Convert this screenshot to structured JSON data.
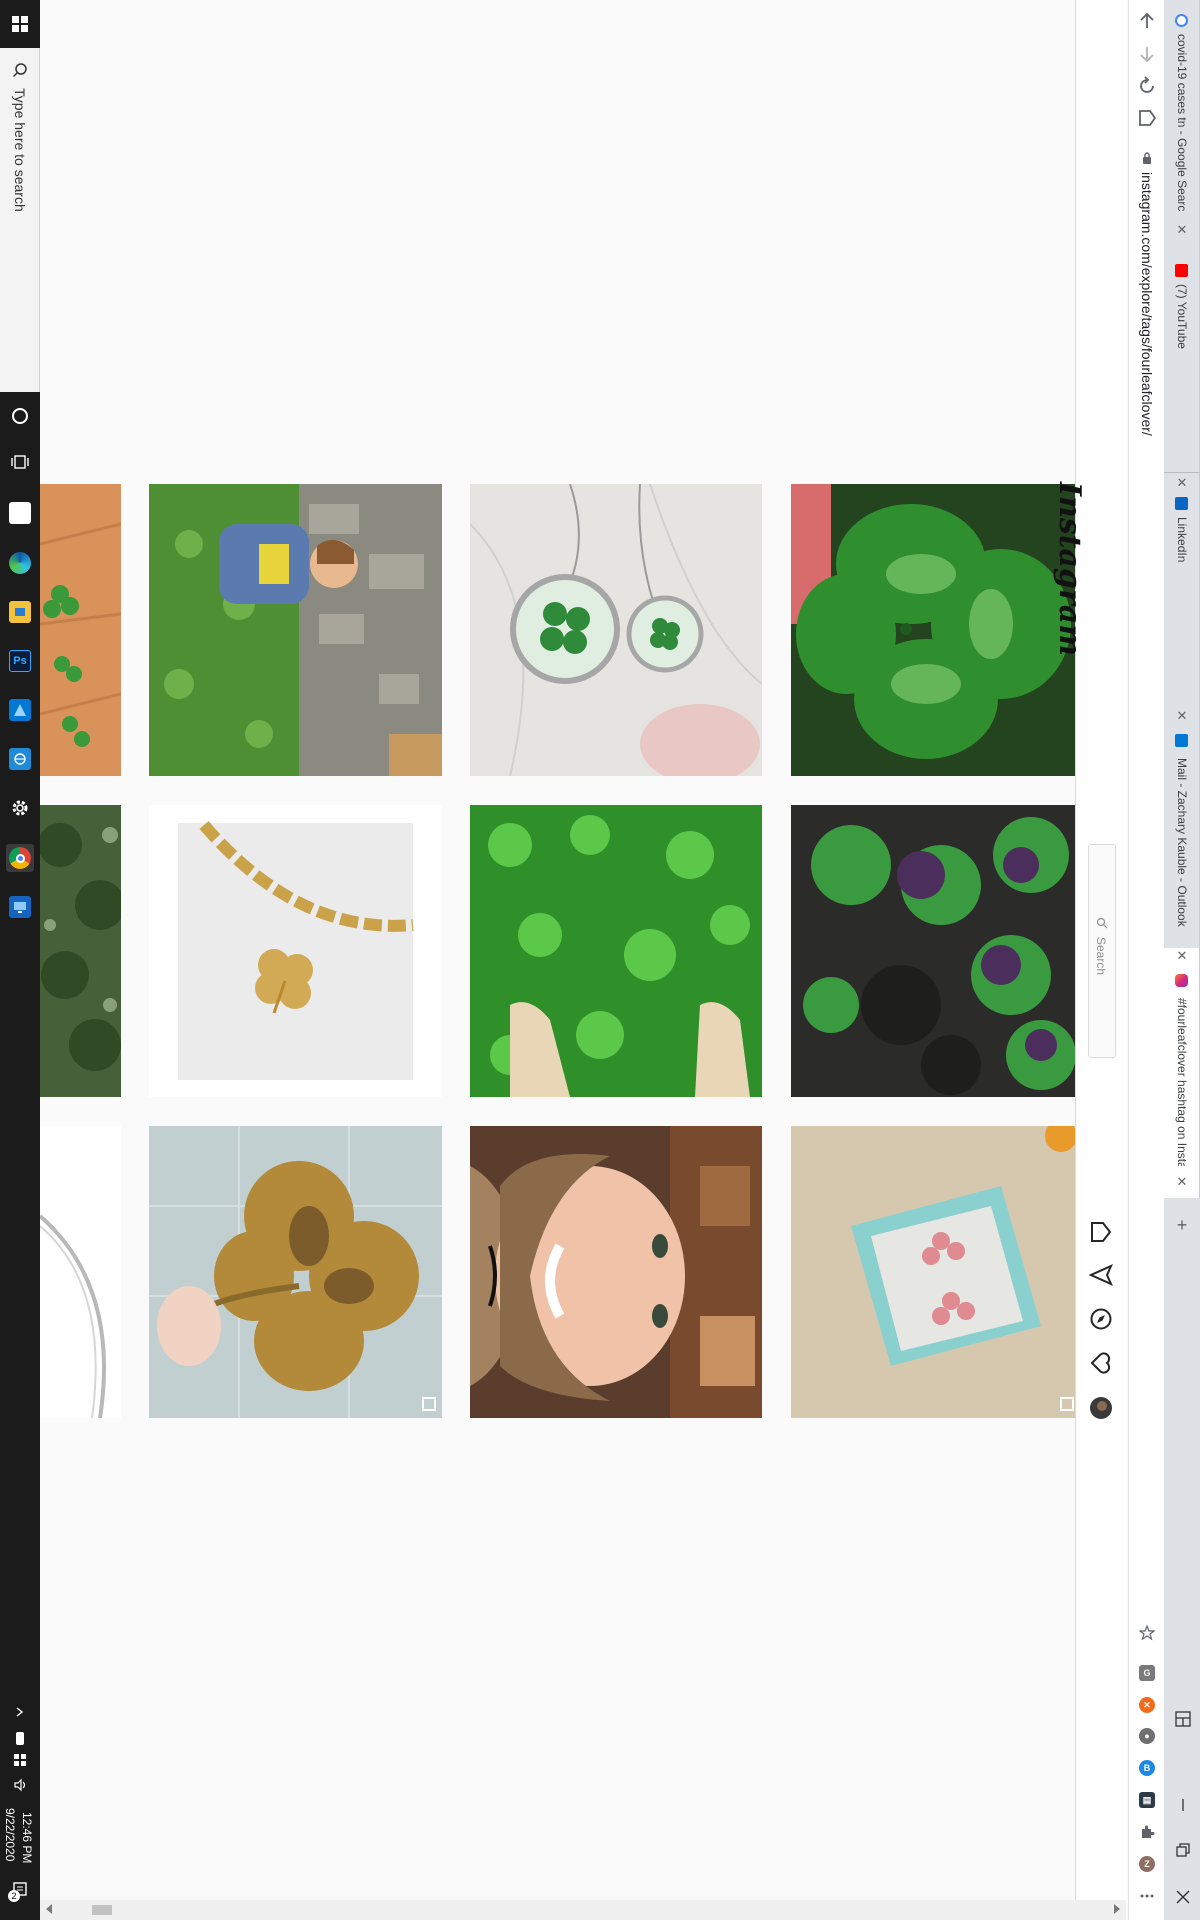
{
  "taskbar": {
    "search_placeholder": "Type here to search",
    "time": "12:46 PM",
    "date": "9/22/2020",
    "notification_count": "2",
    "apps": [
      "cortana-icon",
      "task-view-icon",
      "microsoft-store-icon",
      "edge-icon",
      "file-explorer-icon",
      "photoshop-icon",
      "azure-icon",
      "network-app-icon",
      "settings-icon",
      "chrome-icon",
      "remote-desktop-icon"
    ]
  },
  "browser": {
    "url": "instagram.com/explore/tags/fourleafclover/",
    "tabs": [
      {
        "title": "covid-19 cases tn - Google Searc",
        "favicon": "google-icon",
        "active": false
      },
      {
        "title": "(7) YouTube",
        "favicon": "youtube-icon",
        "active": false
      },
      {
        "title": "LinkedIn",
        "favicon": "linkedin-icon",
        "active": false
      },
      {
        "title": "Mail - Zachary Kauble - Outlook",
        "favicon": "outlook-icon",
        "active": false
      },
      {
        "title": "#fourleafclover hashtag on Insta",
        "favicon": "instagram-icon",
        "active": true
      }
    ],
    "new_tab": "+",
    "profile_initial": "Z"
  },
  "instagram": {
    "logo": "Instagram",
    "search_placeholder": "Search",
    "nav": [
      "home-icon",
      "direct-icon",
      "explore-icon",
      "activity-icon",
      "profile-avatar"
    ]
  },
  "grid": {
    "tiles": [
      {
        "name": "clover-leaves-on-wood",
        "color": "#d9925a"
      },
      {
        "name": "child-on-stone-wall",
        "color": "#5a8a3a"
      },
      {
        "name": "clover-pendant-necklaces",
        "color": "#e2e0dd"
      },
      {
        "name": "four-leaf-clover-closeup",
        "color": "#2f7a2f"
      },
      {
        "name": "tree-foliage",
        "color": "#3f5a2e"
      },
      {
        "name": "gold-clover-bracelet",
        "color": "#ececec"
      },
      {
        "name": "dog-paws-in-clover",
        "color": "#3aa52c"
      },
      {
        "name": "purple-clover-plants",
        "color": "#2f4a2a"
      },
      {
        "name": "silver-chain-necklace",
        "color": "#ffffff"
      },
      {
        "name": "gold-clover-sculpture",
        "color": "#b9c7c9"
      },
      {
        "name": "smiling-woman-selfie",
        "color": "#6b4a35"
      },
      {
        "name": "clover-earrings-in-box",
        "color": "#d7c8ad"
      }
    ]
  }
}
